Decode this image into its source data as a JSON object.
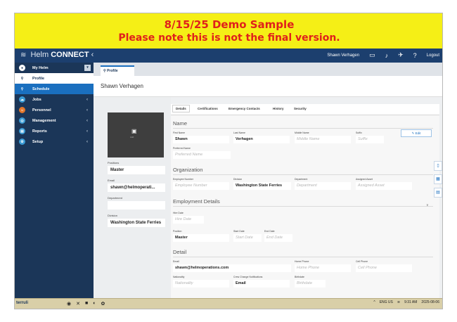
{
  "banner": {
    "line1": "8/15/25 Demo Sample",
    "line2": "Please note this is not the final version."
  },
  "topbar": {
    "brand_prefix": "Helm",
    "brand_name": "CONNECT",
    "collapse_glyph": "‹",
    "user_name": "Shawn Verhagen",
    "logout_label": "Logout",
    "icons": [
      "monitor-icon",
      "bell-icon",
      "pin-icon",
      "help-icon"
    ]
  },
  "sidebar": {
    "items": [
      {
        "label": "My Helm",
        "icon": "user-icon"
      },
      {
        "label": "Profile",
        "icon": "person-icon"
      },
      {
        "label": "Schedule",
        "icon": "schedule-icon"
      },
      {
        "label": "Jobs",
        "icon": "cloud-icon"
      },
      {
        "label": "Personnel",
        "icon": "personnel-icon"
      },
      {
        "label": "Management",
        "icon": "management-icon"
      },
      {
        "label": "Reports",
        "icon": "reports-icon"
      },
      {
        "label": "Setup",
        "icon": "setup-icon"
      }
    ],
    "bottom_glyph": "⊢"
  },
  "page": {
    "tab_label": "Profile",
    "person_name": "Shawn Verhagen"
  },
  "left_info": {
    "photo_label": "Add",
    "position_label": "Positions",
    "position_value": "Master",
    "email_label": "Email",
    "email_value": "shawn@helmoperati...",
    "department_label": "Department",
    "department_value": "",
    "division_label": "Division",
    "division_value": "Washington State Ferries"
  },
  "detail_tabs": [
    "Details",
    "Certifications",
    "Emergency Contacts",
    "History",
    "Security"
  ],
  "edit_label": "Edit",
  "name_section": {
    "title": "Name",
    "first_label": "First Name",
    "first_value": "Shawn",
    "last_label": "Last Name",
    "last_value": "Verhagen",
    "middle_label": "Middle Name",
    "middle_placeholder": "Middle Name",
    "suffix_label": "Suffix",
    "suffix_placeholder": "Suffix",
    "preferred_label": "Preferred Name",
    "preferred_placeholder": "Preferred Name"
  },
  "org_section": {
    "title": "Organization",
    "emp_label": "Employee Number",
    "emp_placeholder": "Employee Number",
    "div_label": "Division",
    "div_value": "Washington State Ferries",
    "dept_label": "Department",
    "dept_placeholder": "Department",
    "asset_label": "Assigned Asset",
    "asset_placeholder": "Assigned Asset"
  },
  "employment_section": {
    "title": "Employment Details",
    "hire_label": "Hire Date",
    "hire_placeholder": "Hire Date",
    "pos_label": "Position",
    "pos_value": "Master",
    "start_label": "Start Date",
    "start_placeholder": "Start Date",
    "end_label": "End Date",
    "end_placeholder": "End Date"
  },
  "detail_section": {
    "title": "Detail",
    "email_label": "Email",
    "email_value": "shawn@helmoperations.com",
    "home_label": "Home Phone",
    "home_placeholder": "Home Phone",
    "cell_label": "Cell Phone",
    "cell_placeholder": "Cell Phone",
    "nat_label": "Nationality",
    "nat_placeholder": "Nationality",
    "crew_label": "Crew Change Notifications",
    "crew_value": "Email",
    "birth_label": "Birthdate",
    "birth_placeholder": "Birthdate"
  },
  "taskbar": {
    "start_label": "terruli",
    "lang": "ENG US",
    "time": "9:31 AM",
    "date": "2025-08-06"
  }
}
